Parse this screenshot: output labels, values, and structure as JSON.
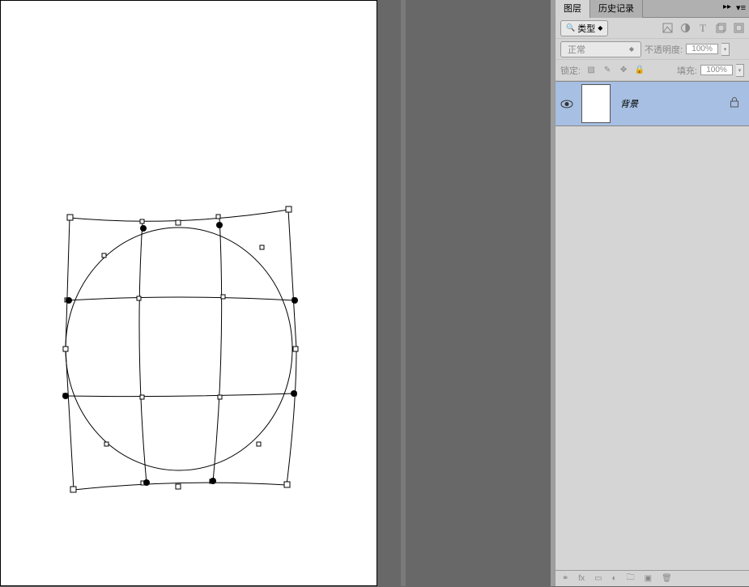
{
  "panel": {
    "tabs": {
      "layers": "图层",
      "history": "历史记录"
    },
    "filter": {
      "label": "类型"
    },
    "blend": {
      "mode": "正常",
      "opacity_label": "不透明度:",
      "opacity_value": "100%"
    },
    "lock": {
      "label": "锁定:",
      "fill_label": "填充:",
      "fill_value": "100%"
    }
  },
  "layers": [
    {
      "name": "背景"
    }
  ]
}
